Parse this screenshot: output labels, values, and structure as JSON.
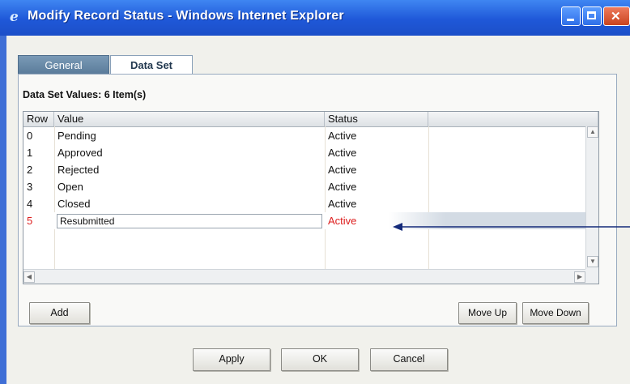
{
  "window": {
    "title": "Modify Record Status - Windows Internet Explorer"
  },
  "tabs": [
    {
      "label": "General"
    },
    {
      "label": "Data Set"
    }
  ],
  "dataset": {
    "heading": "Data Set Values:  6 Item(s)"
  },
  "table": {
    "headers": [
      "Row",
      "Value",
      "Status"
    ],
    "rows": [
      {
        "row": "0",
        "value": "Pending",
        "status": "Active"
      },
      {
        "row": "1",
        "value": "Approved",
        "status": "Active"
      },
      {
        "row": "2",
        "value": "Rejected",
        "status": "Active"
      },
      {
        "row": "3",
        "value": "Open",
        "status": "Active"
      },
      {
        "row": "4",
        "value": "Closed",
        "status": "Active"
      },
      {
        "row": "5",
        "value": "Resubmitted",
        "status": "Active"
      }
    ]
  },
  "buttons": {
    "add": "Add",
    "move_up": "Move Up",
    "move_down": "Move Down",
    "apply": "Apply",
    "ok": "OK",
    "cancel": "Cancel"
  },
  "icons": {
    "title_icon": "ie-icon",
    "minimize": "minimize-icon",
    "maximize": "maximize-icon",
    "close": "close-icon"
  },
  "colors": {
    "titlebar": "#1f58d8",
    "new_row_text": "#dd1d1d",
    "annotation_arrow": "#142a7a"
  }
}
